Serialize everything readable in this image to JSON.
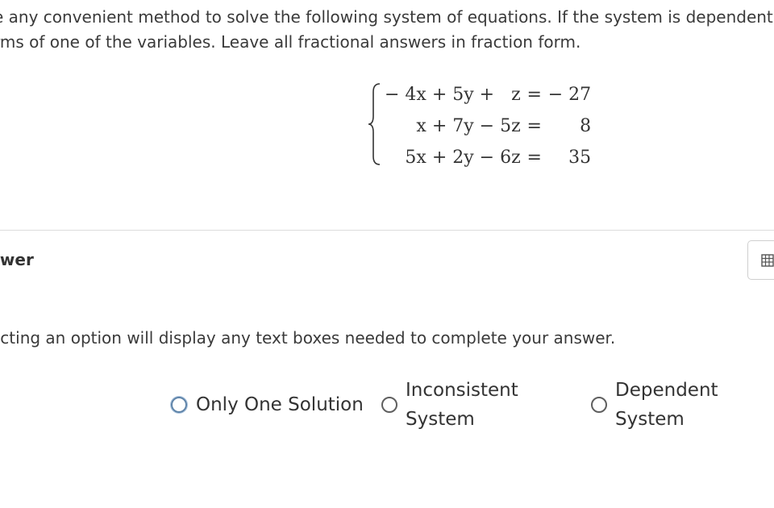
{
  "instructions": {
    "line1": "e any convenient method to solve the following system of equations. If the system is dependent, ex",
    "line2": "rms of one of the variables. Leave all fractional answers in fraction form."
  },
  "system": {
    "equations": [
      {
        "lhs": "− 4x + 5y +   z",
        "eq": "=",
        "rhs": "− 27"
      },
      {
        "lhs": "x + 7y − 5z",
        "eq": "=",
        "rhs": "8"
      },
      {
        "lhs": "5x + 2y − 6z",
        "eq": "=",
        "rhs": "35"
      }
    ]
  },
  "answer": {
    "label": "swer",
    "tool_icon": "table-grid-icon"
  },
  "hint": "ecting an option will display any text boxes needed to complete your answer.",
  "options": [
    {
      "label": "Only One Solution",
      "selected": false,
      "focused": true
    },
    {
      "label": "Inconsistent System",
      "selected": false,
      "focused": false
    },
    {
      "label": "Dependent System",
      "selected": false,
      "focused": false
    }
  ],
  "colors": {
    "divider": "#dcdcdc",
    "focus_ring": "#5f84a9",
    "text": "#333333"
  }
}
